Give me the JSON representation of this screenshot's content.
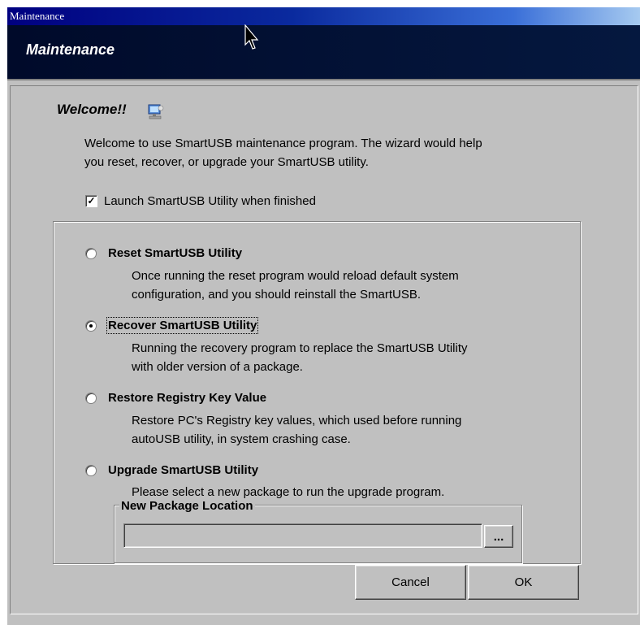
{
  "window": {
    "title": "Maintenance"
  },
  "header": {
    "title": "Maintenance"
  },
  "welcome": {
    "title": "Welcome!!",
    "desc_line1": "Welcome to use SmartUSB maintenance program. The wizard would help",
    "desc_line2": "you reset, recover, or upgrade your SmartUSB utility."
  },
  "launch_checkbox": {
    "label": "Launch SmartUSB Utility when finished",
    "checked": true,
    "mark": "✓"
  },
  "options": [
    {
      "label": "Reset SmartUSB Utility",
      "desc_line1": "Once running the reset program would reload default system",
      "desc_line2": "configuration, and you should reinstall the SmartUSB.",
      "selected": false
    },
    {
      "label": "Recover SmartUSB Utility",
      "desc_line1": "Running the recovery program to replace the SmartUSB Utility",
      "desc_line2": "with older version of a package.",
      "selected": true
    },
    {
      "label": "Restore Registry Key Value",
      "desc_line1": "Restore PC's Registry key values, which used before running",
      "desc_line2": "autoUSB utility, in system crashing case.",
      "selected": false
    },
    {
      "label": "Upgrade SmartUSB Utility",
      "desc_line1": "Please select a new package to run the upgrade program.",
      "selected": false
    }
  ],
  "package_location": {
    "legend": "New Package Location",
    "value": "",
    "browse_label": "..."
  },
  "buttons": {
    "cancel": "Cancel",
    "ok": "OK"
  },
  "colors": {
    "face": "#c0c0c0",
    "title_gradient_start": "#000080",
    "header_bg": "#000a2a"
  },
  "icons": {
    "welcome": "computer-icon",
    "cursor": "mouse-pointer-icon"
  }
}
